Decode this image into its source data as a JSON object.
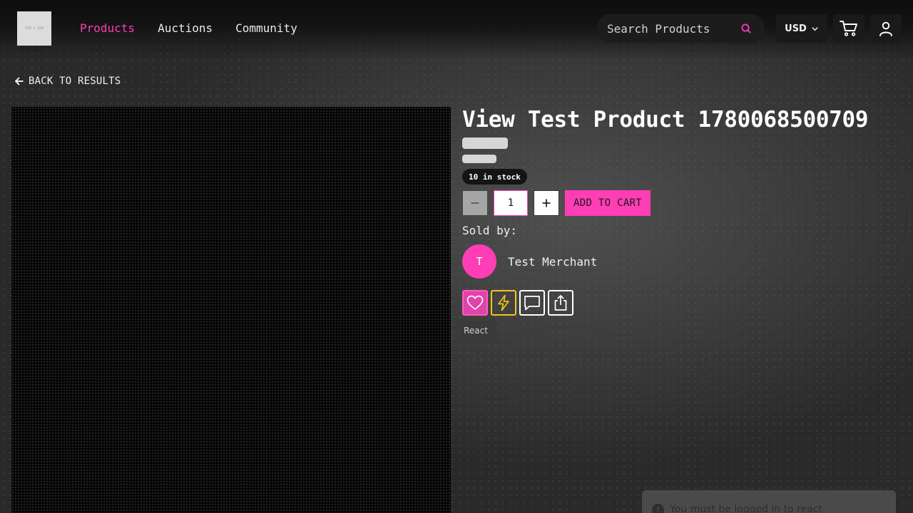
{
  "header": {
    "logo_text": "200 × 200",
    "nav": [
      {
        "label": "Products",
        "active": true
      },
      {
        "label": "Auctions",
        "active": false
      },
      {
        "label": "Community",
        "active": false
      }
    ],
    "search": {
      "placeholder": "Search Products",
      "icon": "search-icon"
    },
    "currency": "USD",
    "icons": {
      "cart": "cart-icon",
      "account": "user-icon"
    }
  },
  "back_link": "BACK TO RESULTS",
  "product": {
    "title": "View Test Product 1780068500709",
    "stock": "10 in stock",
    "quantity": "1",
    "add_to_cart": "ADD TO CART",
    "sold_by_label": "Sold by:",
    "merchant": {
      "initial": "T",
      "name": "Test Merchant"
    },
    "actions": [
      {
        "name": "react",
        "icon": "heart-icon"
      },
      {
        "name": "boost",
        "icon": "lightning-icon"
      },
      {
        "name": "comment",
        "icon": "chat-icon"
      },
      {
        "name": "share",
        "icon": "share-icon"
      }
    ],
    "tooltip": "React"
  },
  "toast": {
    "message": "You must be logged in to react"
  },
  "colors": {
    "accent": "#ff3eb5",
    "bolt": "#f5c518",
    "background": "#2a2a2a"
  }
}
